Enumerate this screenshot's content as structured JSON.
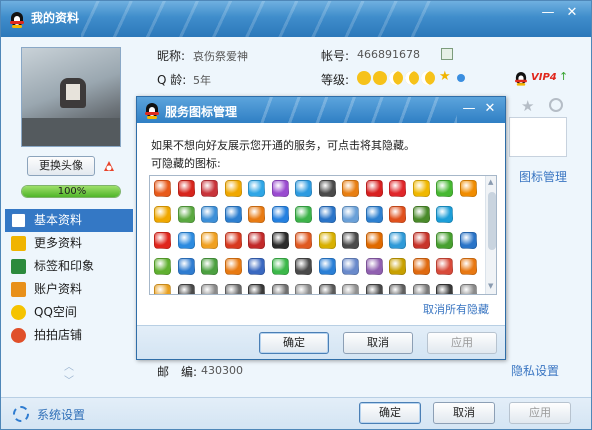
{
  "window": {
    "title": "我的资料"
  },
  "left_panel": {
    "change_avatar_label": "更换头像",
    "progress_percent": 100,
    "progress_label": "100%",
    "nav_items": [
      {
        "label": "基本资料",
        "icon": "profile-card-icon",
        "active": true
      },
      {
        "label": "更多资料",
        "icon": "details-list-icon",
        "active": false
      },
      {
        "label": "标签和印象",
        "icon": "tag-icon",
        "active": false
      },
      {
        "label": "账户资料",
        "icon": "account-icon",
        "active": false
      },
      {
        "label": "QQ空间",
        "icon": "qzone-star-icon",
        "active": false
      },
      {
        "label": "拍拍店铺",
        "icon": "shop-icon",
        "active": false
      }
    ],
    "settings_label": "系统设置"
  },
  "profile": {
    "nickname_label": "昵称:",
    "nickname": "哀伤祭爱神",
    "account_label": "帐号:",
    "account": "466891678",
    "age_label": "Q 龄:",
    "age": "5年",
    "level_label": "等级:",
    "vip_label": "VIP4",
    "zip_label": "邮　编:",
    "zip": "430300",
    "icon_manage_link": "图标管理",
    "privacy_link": "隐私设置"
  },
  "dialog": {
    "title": "服务图标管理",
    "description": "如果不想向好友展示您开通的服务，可点击将其隐藏。",
    "hide_label": "可隐藏的图标:",
    "cancel_all_hide": "取消所有隐藏",
    "ok": "确定",
    "cancel": "取消",
    "apply": "应用"
  },
  "footer": {
    "ok": "确定",
    "cancel": "取消",
    "apply": "应用"
  },
  "service_icon_colors": [
    [
      "#e85a1b",
      "#d7251c",
      "#c8343a",
      "#f0a800",
      "#2fa6e6",
      "#9a4bd0",
      "#2e9be0",
      "#4a4a4a",
      "#e87f12",
      "#d82020",
      "#e0262a",
      "#f0b800",
      "#47b832",
      "#f08c00"
    ],
    [
      "#f0a800",
      "#5aa840",
      "#3c8fd8",
      "#2d7fd0",
      "#e87a12",
      "#2480e0",
      "#3db34a",
      "#2a74c8",
      "#6aa0d8",
      "#2d80d0",
      "#e0501c",
      "#4a8a2a",
      "#1c9ed8"
    ],
    [
      "#e0251c",
      "#2c8be0",
      "#f0a020",
      "#d83a20",
      "#c22a2a",
      "#2c2c2c",
      "#e05a22",
      "#d8b000",
      "#4a4a4a",
      "#e06a00",
      "#2f9ad8",
      "#c8342a",
      "#48a030",
      "#2a74c8"
    ],
    [
      "#60b030",
      "#2f7cd0",
      "#4ca040",
      "#e87a12",
      "#3a68c0",
      "#3cb84a",
      "#4a4a4a",
      "#2a7fd6",
      "#6a8acb",
      "#9060b0",
      "#c8a000",
      "#e06a10",
      "#d84a3a",
      "#e87812"
    ],
    [
      "#e8a020",
      "#4a4a4a",
      "#8a8a8a",
      "#6a6a6a",
      "#3a3a3a",
      "#707070",
      "#8a8a8a",
      "#5a5a5a",
      "#909090",
      "#4a4a4a",
      "#606060",
      "#7a7a7a",
      "#3a3a3a",
      "#8a8a8a"
    ]
  ]
}
